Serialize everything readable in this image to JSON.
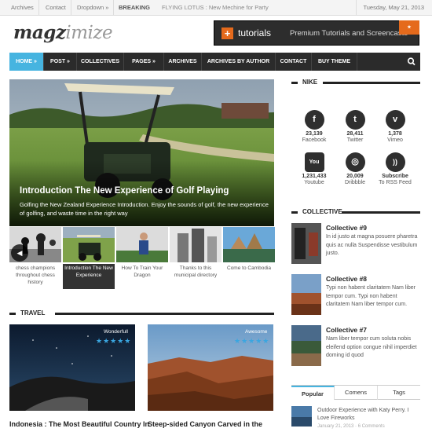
{
  "topbar": {
    "links": [
      "Archives",
      "Contact",
      "Dropdown »"
    ],
    "breaking_label": "BREAKING",
    "ticker": "FLYING LOTUS : New Mechine for Party",
    "date": "Tuesday, May 21, 2013"
  },
  "logo": {
    "part1": "magz",
    "part2": "imize"
  },
  "banner": {
    "name": "tutorials",
    "desc": "Premium Tutorials and Screencasts"
  },
  "nav": {
    "items": [
      "HOME »",
      "POST »",
      "COLLECTIVES",
      "PAGES »",
      "ARCHIVES",
      "ARCHIVES BY AUTHOR",
      "CONTACT",
      "BUY THEME"
    ],
    "search_icon": "search-icon"
  },
  "hero": {
    "title": "Introduction The New Experience of Golf Playing",
    "desc": "Golfing the New Zealand Experience Introduction. Enjoy the sounds of golf, the new experience of golfing, and waste time in the right way"
  },
  "thumbs": [
    {
      "caption": "chess champions throughout chess history"
    },
    {
      "caption": "Introduction The New Experience"
    },
    {
      "caption": "How To Train Your Dragon"
    },
    {
      "caption": "Thanks to this municipal directory"
    },
    {
      "caption": "Come to Cambodia"
    }
  ],
  "travel": {
    "label": "TRAVEL",
    "cards": [
      {
        "badge": "Wonderfull",
        "stars": "★★★★★",
        "title": "Indonesia : The Most Beautiful Country In"
      },
      {
        "badge": "Awesome",
        "stars": "★★★★★",
        "title": "Steep-sided Canyon Carved in the"
      }
    ]
  },
  "nike": {
    "label": "NIKE",
    "social": [
      {
        "icon": "facebook-icon",
        "glyph": "f",
        "count": "23,139",
        "name": "Facebook"
      },
      {
        "icon": "twitter-icon",
        "glyph": "t",
        "count": "28,411",
        "name": "Twitter"
      },
      {
        "icon": "vimeo-icon",
        "glyph": "v",
        "count": "1,378",
        "name": "Vimeo"
      },
      {
        "icon": "youtube-icon",
        "glyph": "You",
        "count": "1,231,433",
        "name": "Youtube"
      },
      {
        "icon": "dribbble-icon",
        "glyph": "◎",
        "count": "20,009",
        "name": "Dribbble"
      },
      {
        "icon": "rss-icon",
        "glyph": "))",
        "count": "Subscribe",
        "name": "To RSS Feed"
      }
    ]
  },
  "collective": {
    "label": "COLLECTIVE",
    "items": [
      {
        "title": "Collective #9",
        "desc": "In id justo at magna posuere pharetra quis ac nulla Suspendisse vestibulum justo."
      },
      {
        "title": "Collective #8",
        "desc": "Typi non habent claritatem Nam liber tempor cum. Typi non habent claritatem Nam liber tempor cum."
      },
      {
        "title": "Collective #7",
        "desc": "Nam liber tempor cum soluta nobis eleifend option congue nihil imperdiet doming id quod"
      }
    ]
  },
  "tabs": {
    "items": [
      "Popular",
      "Comens",
      "Tags"
    ],
    "popular_title": "Outdoor Experience with Katy Perry. I Love Fireworks",
    "popular_meta": "January 21, 2013 · 6 Comments"
  },
  "colors": {
    "accent": "#46b4e0",
    "dark": "#2b2b2b",
    "orange": "#e56a1c"
  }
}
